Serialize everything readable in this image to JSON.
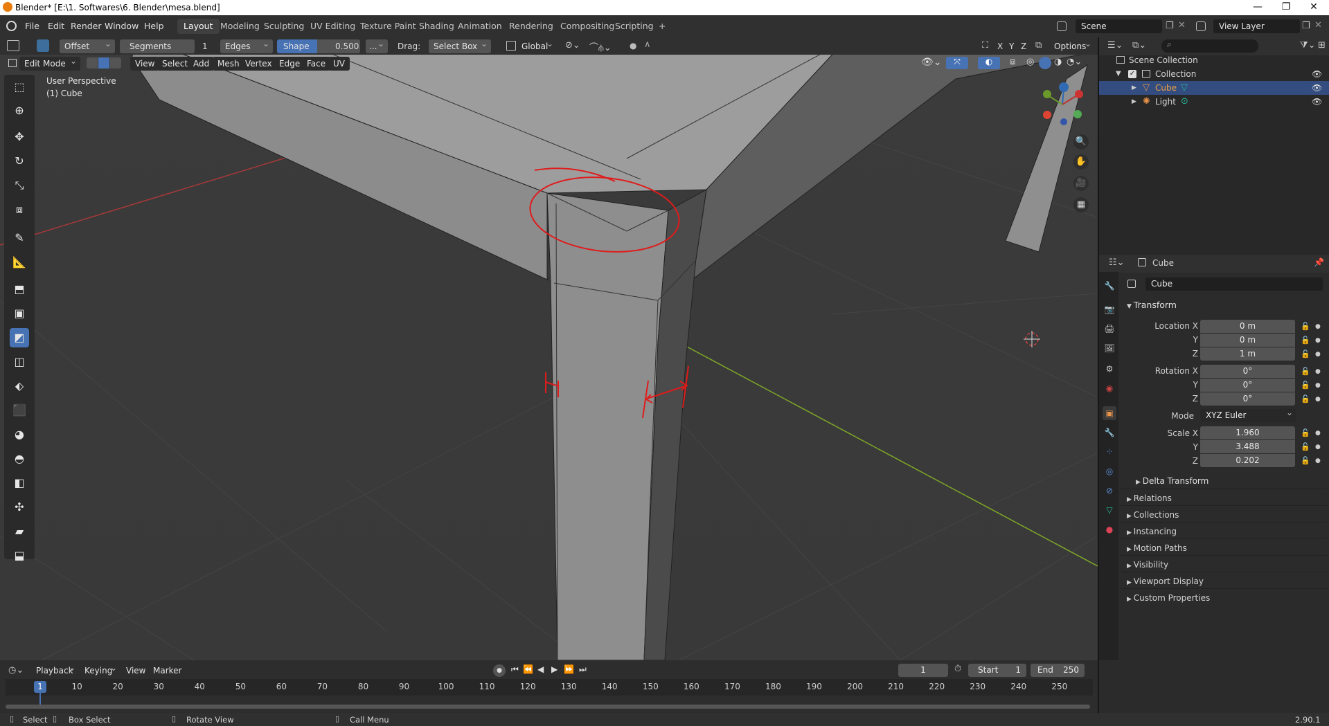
{
  "window": {
    "title": "Blender* [E:\\1. Softwares\\6. Blender\\mesa.blend]",
    "minimize": "—",
    "maximize": "❐",
    "close": "✕"
  },
  "menus": [
    "File",
    "Edit",
    "Render",
    "Window",
    "Help"
  ],
  "workspaces": [
    "Layout",
    "Modeling",
    "Sculpting",
    "UV Editing",
    "Texture Paint",
    "Shading",
    "Animation",
    "Rendering",
    "Compositing",
    "Scripting"
  ],
  "add_workspace": "+",
  "scene": {
    "label": "Scene",
    "view_layer": "View Layer"
  },
  "tool_header": {
    "offset": "Offset",
    "segments_label": "Segments",
    "segments_value": "1",
    "edges": "Edges",
    "shape_label": "Shape",
    "shape_value": "0.500",
    "more": "...",
    "drag_label": "Drag:",
    "drag_value": "Select Box",
    "orientation": "Global",
    "x": "X",
    "y": "Y",
    "z": "Z",
    "options": "Options"
  },
  "mode_header": {
    "mode": "Edit Mode",
    "items": [
      "View",
      "Select",
      "Add",
      "Mesh",
      "Vertex",
      "Edge",
      "Face",
      "UV"
    ]
  },
  "viewport": {
    "perspective": "User Perspective",
    "object": "(1) Cube"
  },
  "outliner": {
    "root": "Scene Collection",
    "collection": "Collection",
    "items": [
      {
        "name": "Cube",
        "selected": true
      },
      {
        "name": "Light",
        "selected": false
      }
    ]
  },
  "properties": {
    "header_object": "Cube",
    "name_field": "Cube",
    "transform_label": "Transform",
    "location": {
      "label_x": "Location X",
      "label_y": "Y",
      "label_z": "Z",
      "x": "0 m",
      "y": "0 m",
      "z": "1 m"
    },
    "rotation": {
      "label_x": "Rotation X",
      "label_y": "Y",
      "label_z": "Z",
      "x": "0°",
      "y": "0°",
      "z": "0°"
    },
    "mode_label": "Mode",
    "mode_value": "XYZ Euler",
    "scale": {
      "label_x": "Scale X",
      "label_y": "Y",
      "label_z": "Z",
      "x": "1.960",
      "y": "3.488",
      "z": "0.202"
    },
    "delta": "Delta Transform",
    "sections": [
      "Relations",
      "Collections",
      "Instancing",
      "Motion Paths",
      "Visibility",
      "Viewport Display",
      "Custom Properties"
    ]
  },
  "timeline": {
    "menus": [
      "Playback",
      "Keying",
      "View",
      "Marker"
    ],
    "current_frame": "1",
    "start_label": "Start",
    "start": "1",
    "end_label": "End",
    "end": "250",
    "ticks": [
      "1",
      "10",
      "20",
      "30",
      "40",
      "50",
      "60",
      "70",
      "80",
      "90",
      "100",
      "110",
      "120",
      "130",
      "140",
      "150",
      "160",
      "170",
      "180",
      "190",
      "200",
      "210",
      "220",
      "230",
      "240",
      "250"
    ]
  },
  "statusbar": {
    "select": "Select",
    "box_select": "Box Select",
    "rotate_view": "Rotate View",
    "call_menu": "Call Menu",
    "version": "2.90.1"
  },
  "colors": {
    "accent": "#4772b3",
    "annotation": "#e01b1b",
    "x_axis": "#c83232",
    "y_axis": "#7fa826",
    "cube_icon": "#e8934a"
  }
}
